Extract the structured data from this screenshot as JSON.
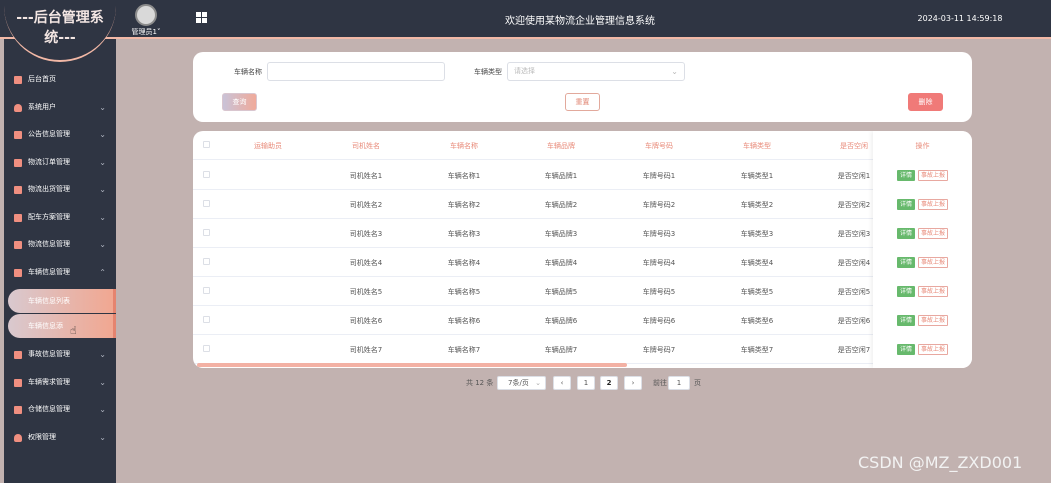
{
  "app": {
    "logo": "---后台管理系统---",
    "user_label": "管理员1˅",
    "title": "欢迎使用某物流企业管理信息系统",
    "datetime": "2024-03-11 14:59:18"
  },
  "sidebar": {
    "items": [
      {
        "label": "后台首页",
        "icon": "monitor-icon",
        "chev": ""
      },
      {
        "label": "系统用户",
        "icon": "person-icon",
        "chev": "⌄"
      },
      {
        "label": "公告信息管理",
        "icon": "doc-icon",
        "chev": "⌄"
      },
      {
        "label": "物流订单管理",
        "icon": "doc-icon",
        "chev": "⌄"
      },
      {
        "label": "物流出货管理",
        "icon": "doc-icon",
        "chev": "⌄"
      },
      {
        "label": "配车方案管理",
        "icon": "doc-icon",
        "chev": "⌄"
      },
      {
        "label": "物流信息管理",
        "icon": "doc-icon",
        "chev": "⌄"
      },
      {
        "label": "车辆信息管理",
        "icon": "doc-icon",
        "chev": "⌃"
      }
    ],
    "sub_items": [
      {
        "label": "车辆信息列表"
      },
      {
        "label": "车辆信息添"
      }
    ],
    "items_after": [
      {
        "label": "事故信息管理",
        "icon": "doc-icon",
        "chev": "⌄"
      },
      {
        "label": "车辆需求管理",
        "icon": "doc-icon",
        "chev": "⌄"
      },
      {
        "label": "仓储信息管理",
        "icon": "doc-icon",
        "chev": "⌄"
      },
      {
        "label": "权限管理",
        "icon": "person-icon",
        "chev": "⌄"
      }
    ]
  },
  "search": {
    "name_label": "车辆名称",
    "name_value": "",
    "type_label": "车辆类型",
    "type_placeholder": "请选择",
    "search_btn": "查询",
    "reset_btn": "重置",
    "delete_btn": "删除"
  },
  "table": {
    "headers": {
      "c1": "运输助员",
      "c2": "司机姓名",
      "c3": "车辆名称",
      "c4": "车辆品牌",
      "c5": "车牌号码",
      "c6": "车辆类型",
      "c7": "是否空闲",
      "op": "操作"
    },
    "rows": [
      {
        "driver": "司机姓名1",
        "name": "车辆名称1",
        "brand": "车辆品牌1",
        "plate": "车牌号码1",
        "type": "车辆类型1",
        "idle": "是否空闲1"
      },
      {
        "driver": "司机姓名2",
        "name": "车辆名称2",
        "brand": "车辆品牌2",
        "plate": "车牌号码2",
        "type": "车辆类型2",
        "idle": "是否空闲2"
      },
      {
        "driver": "司机姓名3",
        "name": "车辆名称3",
        "brand": "车辆品牌3",
        "plate": "车牌号码3",
        "type": "车辆类型3",
        "idle": "是否空闲3"
      },
      {
        "driver": "司机姓名4",
        "name": "车辆名称4",
        "brand": "车辆品牌4",
        "plate": "车牌号码4",
        "type": "车辆类型4",
        "idle": "是否空闲4"
      },
      {
        "driver": "司机姓名5",
        "name": "车辆名称5",
        "brand": "车辆品牌5",
        "plate": "车牌号码5",
        "type": "车辆类型5",
        "idle": "是否空闲5"
      },
      {
        "driver": "司机姓名6",
        "name": "车辆名称6",
        "brand": "车辆品牌6",
        "plate": "车牌号码6",
        "type": "车辆类型6",
        "idle": "是否空闲6"
      },
      {
        "driver": "司机姓名7",
        "name": "车辆名称7",
        "brand": "车辆品牌7",
        "plate": "车牌号码7",
        "type": "车辆类型7",
        "idle": "是否空闲7"
      }
    ],
    "detail_btn": "详情",
    "report_btn": "事故上报"
  },
  "pagination": {
    "total": "共 12 条",
    "page_size": "7条/页",
    "prev": "‹",
    "pages": [
      "1",
      "2"
    ],
    "next": "›",
    "goto_label": "前往",
    "goto_value": "1",
    "page_unit": "页"
  },
  "watermark": "CSDN @MZ_ZXD001",
  "colors": {
    "sidebar_bg": "#2f3543",
    "accent": "#f08f80",
    "page_bg": "#c2b2b0"
  }
}
